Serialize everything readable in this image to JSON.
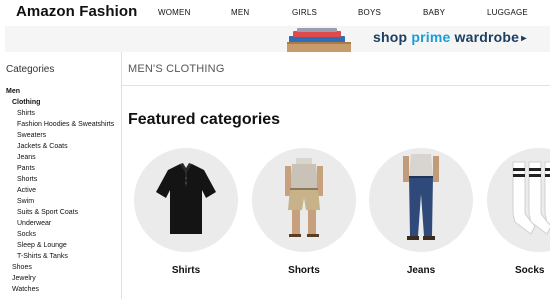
{
  "header": {
    "brand": "Amazon Fashion",
    "nav": [
      "WOMEN",
      "MEN",
      "GIRLS",
      "BOYS",
      "BABY",
      "LUGGAGE"
    ]
  },
  "banner": {
    "text_shop": "shop ",
    "text_prime": "prime",
    "text_wardrobe": " wardrobe",
    "arrow": "▸"
  },
  "sidebar": {
    "title": "Categories",
    "items": [
      {
        "label": "Men",
        "level": 0
      },
      {
        "label": "Clothing",
        "level": 1
      },
      {
        "label": "Shirts",
        "level": 2
      },
      {
        "label": "Fashion Hoodies & Sweatshirts",
        "level": 2
      },
      {
        "label": "Sweaters",
        "level": 2
      },
      {
        "label": "Jackets & Coats",
        "level": 2
      },
      {
        "label": "Jeans",
        "level": 2
      },
      {
        "label": "Pants",
        "level": 2
      },
      {
        "label": "Shorts",
        "level": 2
      },
      {
        "label": "Active",
        "level": 2
      },
      {
        "label": "Swim",
        "level": 2
      },
      {
        "label": "Suits & Sport Coats",
        "level": 2
      },
      {
        "label": "Underwear",
        "level": 2
      },
      {
        "label": "Socks",
        "level": 2
      },
      {
        "label": "Sleep & Lounge",
        "level": 2
      },
      {
        "label": "T-Shirts & Tanks",
        "level": 2
      },
      {
        "label": "Shoes",
        "level": 1.5
      },
      {
        "label": "Jewelry",
        "level": 1.5
      },
      {
        "label": "Watches",
        "level": 1.5
      }
    ]
  },
  "main": {
    "heading": "MEN'S CLOTHING",
    "featured_title": "Featured categories",
    "categories": [
      {
        "label": "Shirts",
        "icon": "polo-shirt-icon"
      },
      {
        "label": "Shorts",
        "icon": "shorts-icon"
      },
      {
        "label": "Jeans",
        "icon": "jeans-icon"
      },
      {
        "label": "Socks",
        "icon": "socks-icon"
      }
    ]
  }
}
